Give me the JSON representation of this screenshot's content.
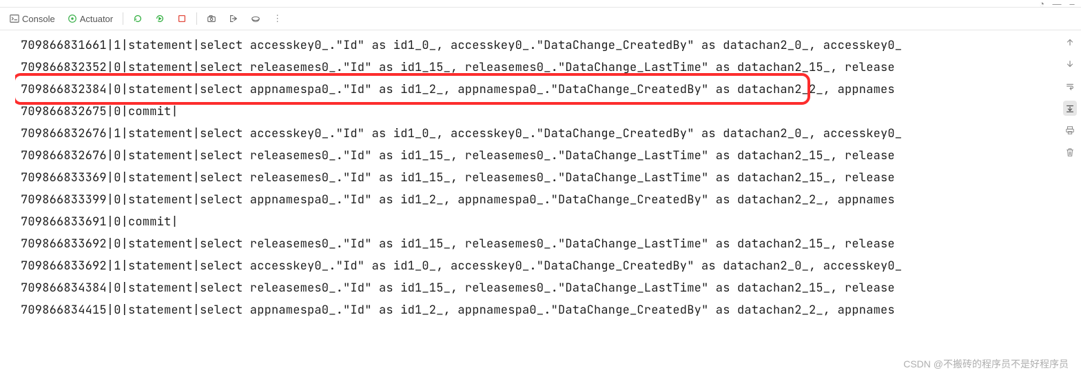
{
  "titlebar": {
    "clock_icon": "◔",
    "minimize": "—",
    "shrink": "–"
  },
  "toolbar": {
    "console_label": "Console",
    "actuator_label": "Actuator",
    "rerun_icon": "rerun",
    "rerun2_icon": "rerun2",
    "stop_icon": "stop",
    "camera_icon": "camera",
    "exit_icon": "exit",
    "cover_icon": "cover",
    "more_icon": "⋮"
  },
  "log": {
    "lines": [
      "709866831661|1|statement|select accesskey0_.\"Id\" as id1_0_, accesskey0_.\"DataChange_CreatedBy\" as datachan2_0_, accesskey0_",
      "709866832352|0|statement|select releasemes0_.\"Id\" as id1_15_, releasemes0_.\"DataChange_LastTime\" as datachan2_15_, release",
      "709866832384|0|statement|select appnamespa0_.\"Id\" as id1_2_, appnamespa0_.\"DataChange_CreatedBy\" as datachan2_2_, appnames",
      "709866832675|0|commit|",
      "709866832676|1|statement|select accesskey0_.\"Id\" as id1_0_, accesskey0_.\"DataChange_CreatedBy\" as datachan2_0_, accesskey0_",
      "709866832676|0|statement|select releasemes0_.\"Id\" as id1_15_, releasemes0_.\"DataChange_LastTime\" as datachan2_15_, release",
      "709866833369|0|statement|select releasemes0_.\"Id\" as id1_15_, releasemes0_.\"DataChange_LastTime\" as datachan2_15_, release",
      "709866833399|0|statement|select appnamespa0_.\"Id\" as id1_2_, appnamespa0_.\"DataChange_CreatedBy\" as datachan2_2_, appnames",
      "709866833691|0|commit|",
      "709866833692|0|statement|select releasemes0_.\"Id\" as id1_15_, releasemes0_.\"DataChange_LastTime\" as datachan2_15_, release",
      "709866833692|1|statement|select accesskey0_.\"Id\" as id1_0_, accesskey0_.\"DataChange_CreatedBy\" as datachan2_0_, accesskey0_",
      "709866834384|0|statement|select releasemes0_.\"Id\" as id1_15_, releasemes0_.\"DataChange_LastTime\" as datachan2_15_, release",
      "709866834415|0|statement|select appnamespa0_.\"Id\" as id1_2_, appnamespa0_.\"DataChange_CreatedBy\" as datachan2_2_, appnames"
    ],
    "highlight_index": 2
  },
  "rightgutter": {
    "up_icon": "up",
    "down_icon": "down",
    "wrap_icon": "wrap",
    "scroll_icon": "scroll",
    "print_icon": "print",
    "delete_icon": "delete"
  },
  "watermark": "CSDN @不搬砖的程序员不是好程序员"
}
